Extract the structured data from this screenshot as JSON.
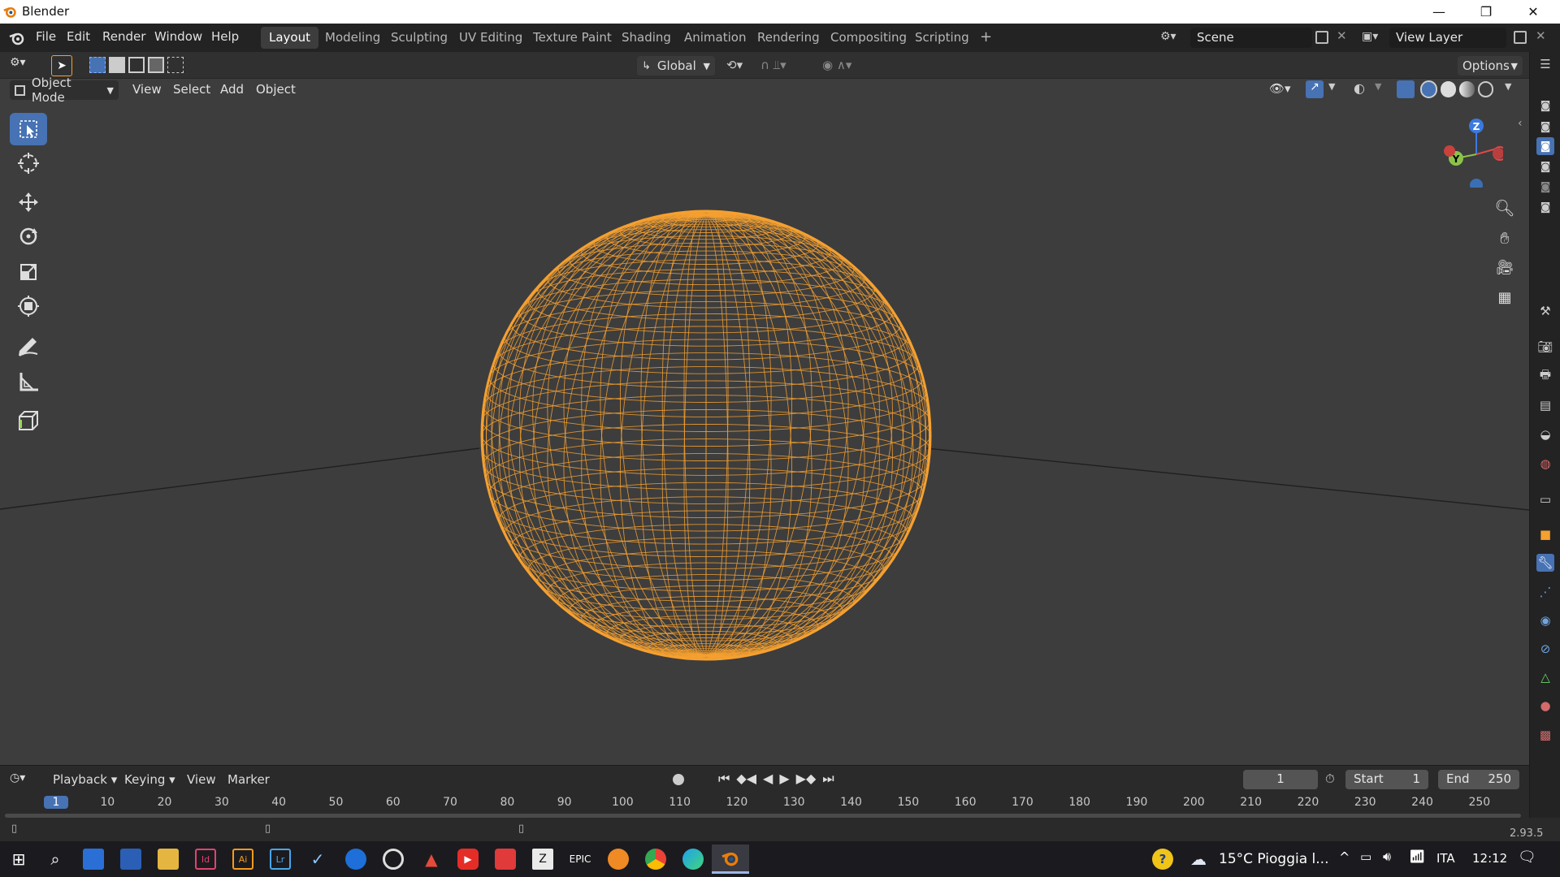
{
  "window": {
    "title": "Blender",
    "minimize": "—",
    "restore": "❐",
    "close": "✕"
  },
  "menu": [
    "File",
    "Edit",
    "Render",
    "Window",
    "Help"
  ],
  "workspaces": [
    "Layout",
    "Modeling",
    "Sculpting",
    "UV Editing",
    "Texture Paint",
    "Shading",
    "Animation",
    "Rendering",
    "Compositing",
    "Scripting"
  ],
  "workspace_add": "+",
  "scene": {
    "name": "Scene",
    "view_layer": "View Layer"
  },
  "tool_header": {
    "orientation": "Global",
    "options": "Options"
  },
  "view_header": {
    "mode": "Object Mode",
    "menus": [
      "View",
      "Select",
      "Add",
      "Object"
    ]
  },
  "gizmo": {
    "z": "Z",
    "y": "Y"
  },
  "timeline": {
    "menus": [
      "Playback",
      "Keying",
      "View",
      "Marker"
    ],
    "current_frame": "1",
    "start_label": "Start",
    "start": "1",
    "end_label": "End",
    "end": "250",
    "ruler": [
      "1",
      "10",
      "20",
      "30",
      "40",
      "50",
      "60",
      "70",
      "80",
      "90",
      "100",
      "110",
      "120",
      "130",
      "140",
      "150",
      "160",
      "170",
      "180",
      "190",
      "200",
      "210",
      "220",
      "230",
      "240",
      "250"
    ]
  },
  "status": {
    "version": "2.93.5"
  },
  "taskbar": {
    "weather": "15°C  Pioggia l...",
    "lang": "ITA",
    "time": "12:12"
  },
  "colors": {
    "accent": "#4772b3",
    "selection": "#f5a030",
    "bg": "#3d3d3d"
  }
}
